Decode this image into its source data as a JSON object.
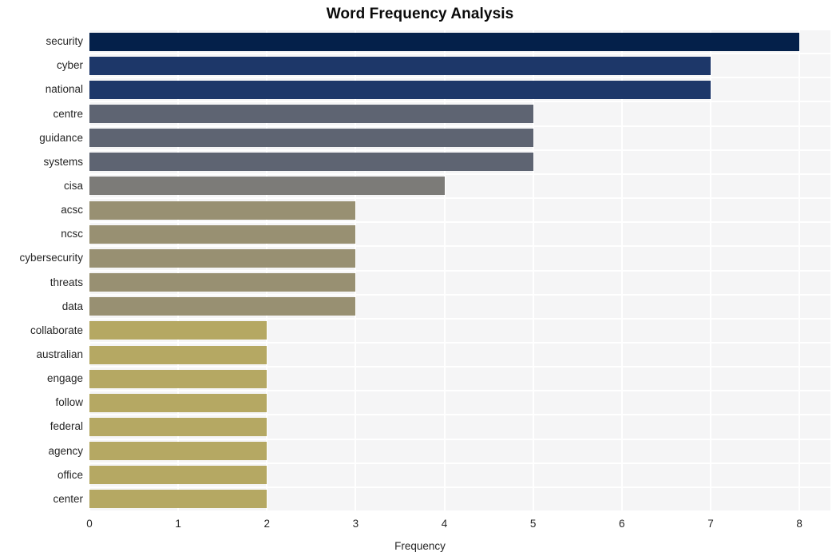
{
  "chart_data": {
    "type": "bar",
    "orientation": "horizontal",
    "title": "Word Frequency Analysis",
    "xlabel": "Frequency",
    "ylabel": "",
    "xlim": [
      0,
      8.35
    ],
    "xticks": [
      "0",
      "1",
      "2",
      "3",
      "4",
      "5",
      "6",
      "7",
      "8"
    ],
    "xtick_values": [
      0,
      1,
      2,
      3,
      4,
      5,
      6,
      7,
      8
    ],
    "grid": true,
    "legend": "none",
    "categories": [
      "security",
      "cyber",
      "national",
      "centre",
      "guidance",
      "systems",
      "cisa",
      "acsc",
      "ncsc",
      "cybersecurity",
      "threats",
      "data",
      "collaborate",
      "australian",
      "engage",
      "follow",
      "federal",
      "agency",
      "office",
      "center"
    ],
    "values": [
      8,
      7,
      7,
      5,
      5,
      5,
      4,
      3,
      3,
      3,
      3,
      3,
      2,
      2,
      2,
      2,
      2,
      2,
      2,
      2
    ],
    "bar_colors": [
      "#04204a",
      "#1d3769",
      "#1d3769",
      "#5e6472",
      "#5e6472",
      "#5e6472",
      "#7c7b78",
      "#989072",
      "#989072",
      "#989072",
      "#989072",
      "#989072",
      "#b5a863",
      "#b5a863",
      "#b5a863",
      "#b5a863",
      "#b5a863",
      "#b5a863",
      "#b5a863",
      "#b5a863"
    ]
  },
  "style": {
    "plot_background": "#f5f5f6",
    "figure_background": "#ffffff",
    "gridline_color": "#ffffff",
    "text_color": "#262626",
    "title_color": "#0a0a0a"
  }
}
